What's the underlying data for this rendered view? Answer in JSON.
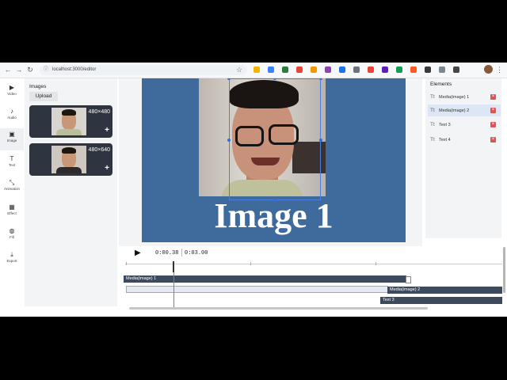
{
  "browser": {
    "url": "localhost:3000/editor",
    "nav": {
      "back": "←",
      "forward": "→",
      "reload": "↻"
    },
    "star": "☆",
    "menu": "⋮",
    "extension_colors": [
      "#f5b400",
      "#3b82f6",
      "#2f7a3e",
      "#e94335",
      "#f29900",
      "#8e44ad",
      "#1a73e8",
      "#6b7280",
      "#ea4335",
      "#5b21b6",
      "#0f9d58",
      "#ff5722",
      "#3a3a3a",
      "#7b8794",
      "#444444"
    ]
  },
  "rail": {
    "items": [
      {
        "icon": "▶",
        "label": "Video"
      },
      {
        "icon": "♪",
        "label": "Audio"
      },
      {
        "icon": "▣",
        "label": "Image"
      },
      {
        "icon": "T",
        "label": "Text"
      },
      {
        "icon": "⤡",
        "label": "Animation"
      },
      {
        "icon": "▦",
        "label": "Effect"
      },
      {
        "icon": "◍",
        "label": "Fill"
      },
      {
        "icon": "⤓",
        "label": "Export"
      }
    ]
  },
  "images_panel": {
    "title": "Images",
    "upload_label": "Upload",
    "items": [
      {
        "dims": "480×480",
        "add": "+"
      },
      {
        "dims": "480×640",
        "add": "+"
      }
    ]
  },
  "canvas": {
    "caption": "Image 1",
    "background": "#3e6a9c"
  },
  "elements_panel": {
    "title": "Elements",
    "items": [
      {
        "label": "Media(image) 1",
        "icon": "T̲T",
        "delete": "×",
        "active": false
      },
      {
        "label": "Media(image) 2",
        "icon": "T̲T",
        "delete": "×",
        "active": true
      },
      {
        "label": "Text 3",
        "icon": "T̲T",
        "delete": "×",
        "active": false
      },
      {
        "label": "Text 4",
        "icon": "T̲T",
        "delete": "×",
        "active": false
      }
    ]
  },
  "playback": {
    "play_icon": "▶",
    "current_time": "0:00.38",
    "total_time": "0:03.00"
  },
  "timeline": {
    "tracks": [
      {
        "label": "Media(image) 1"
      },
      {
        "label": "Media(image) 2"
      },
      {
        "label": "Text 3"
      }
    ]
  }
}
